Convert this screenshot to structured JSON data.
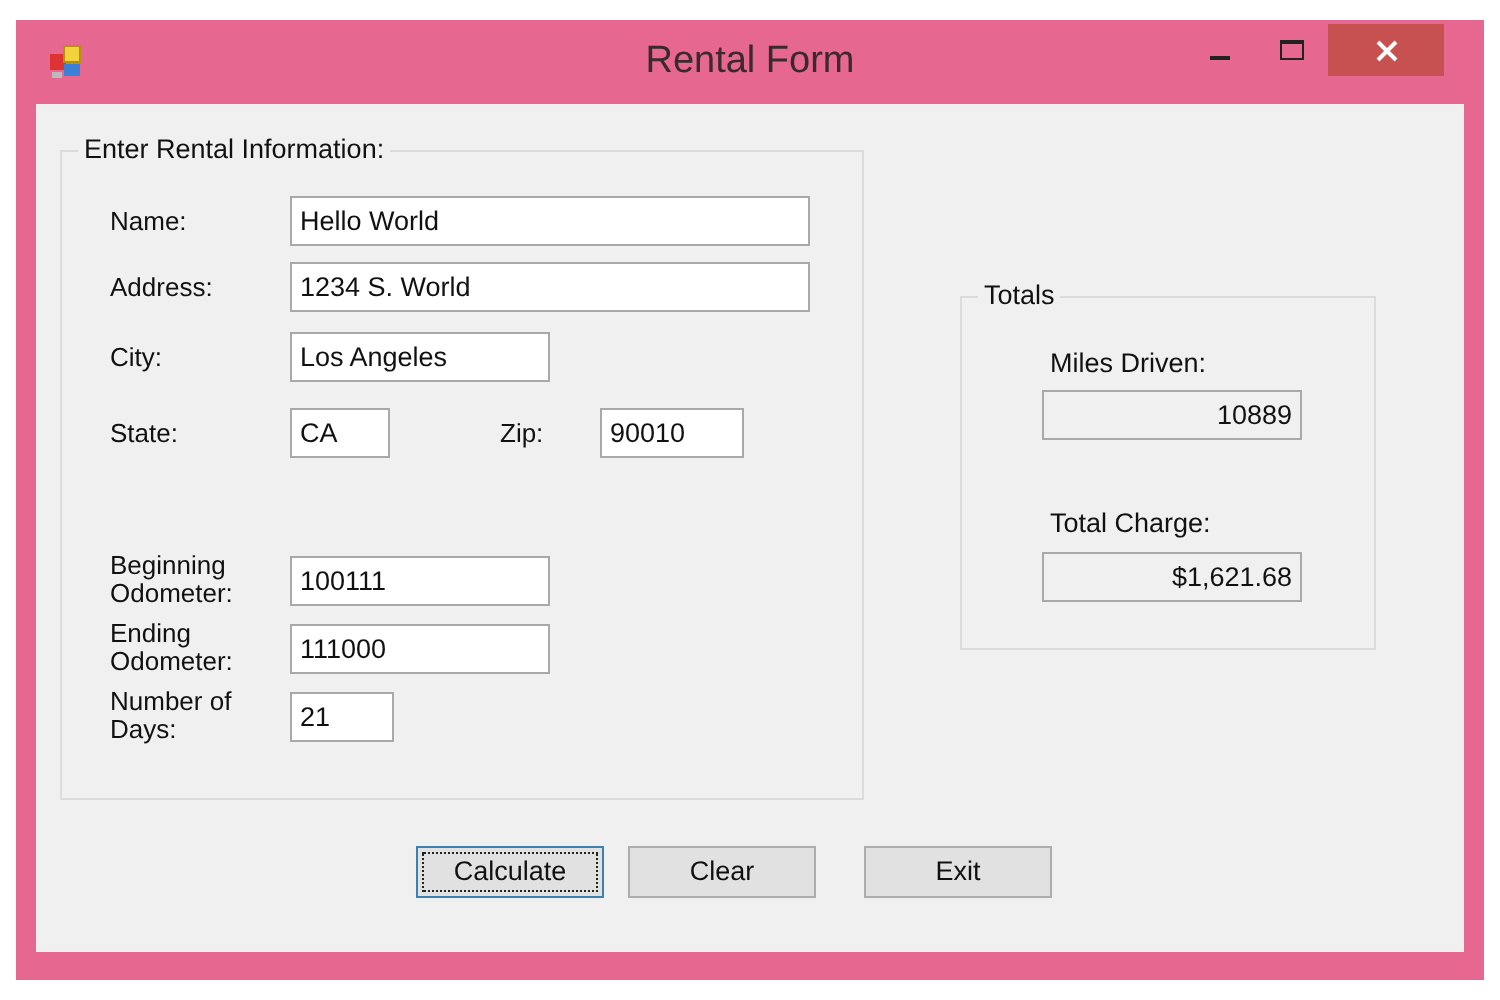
{
  "window": {
    "title": "Rental Form"
  },
  "rental_group": {
    "title": "Enter Rental Information:",
    "rows": [
      [
        {
          "label": "Name:",
          "value": "Hello World"
        }
      ],
      [
        {
          "label": "Address:",
          "value": "1234 S. World"
        }
      ],
      [
        {
          "label": "City:",
          "value": "Los Angeles"
        }
      ],
      [
        {
          "label": "State:",
          "value": "CA"
        },
        {
          "label": "Zip:",
          "value": "90010"
        }
      ],
      [
        {
          "label": "Beginning Odometer:",
          "value": "100111"
        }
      ],
      [
        {
          "label": "Ending Odometer:",
          "value": "111000"
        }
      ],
      [
        {
          "label": "Number of Days:",
          "value": "21"
        }
      ]
    ]
  },
  "totals_group": {
    "title": "Totals",
    "fields": [
      {
        "label": "Miles Driven:",
        "value": "10889"
      },
      {
        "label": "Total Charge:",
        "value": "$1,621.68"
      }
    ]
  },
  "buttons": [
    {
      "label": "Calculate",
      "focused": true
    },
    {
      "label": "Clear",
      "focused": false
    },
    {
      "label": "Exit",
      "focused": false
    }
  ]
}
